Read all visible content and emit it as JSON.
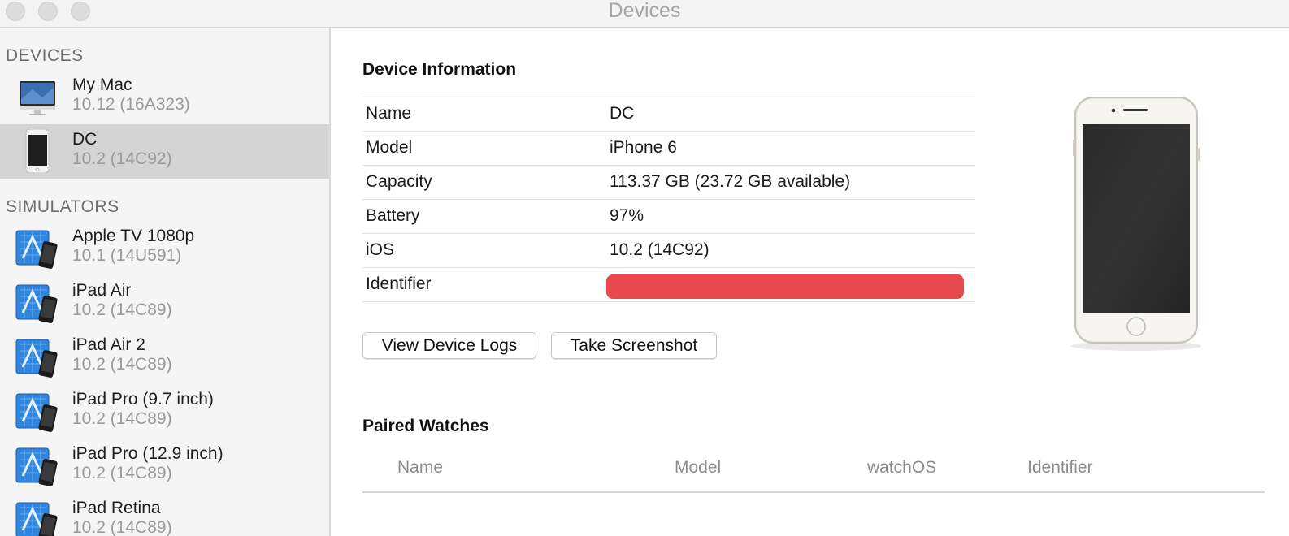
{
  "window": {
    "title": "Devices"
  },
  "sidebar": {
    "devices_header": "DEVICES",
    "simulators_header": "SIMULATORS",
    "devices": [
      {
        "name": "My Mac",
        "version": "10.12 (16A323)",
        "icon": "imac-icon"
      },
      {
        "name": "DC",
        "version": "10.2 (14C92)",
        "icon": "iphone-icon",
        "selected": true
      }
    ],
    "simulators": [
      {
        "name": "Apple TV 1080p",
        "version": "10.1 (14U591)"
      },
      {
        "name": "iPad Air",
        "version": "10.2 (14C89)"
      },
      {
        "name": "iPad Air 2",
        "version": "10.2 (14C89)"
      },
      {
        "name": "iPad Pro (9.7 inch)",
        "version": "10.2 (14C89)"
      },
      {
        "name": "iPad Pro (12.9 inch)",
        "version": "10.2 (14C89)"
      },
      {
        "name": "iPad Retina",
        "version": "10.2 (14C89)"
      }
    ]
  },
  "device_info": {
    "heading": "Device Information",
    "rows": [
      {
        "label": "Name",
        "value": "DC"
      },
      {
        "label": "Model",
        "value": "iPhone 6"
      },
      {
        "label": "Capacity",
        "value": "113.37 GB (23.72 GB available)"
      },
      {
        "label": "Battery",
        "value": "97%"
      },
      {
        "label": "iOS",
        "value": "10.2 (14C92)"
      },
      {
        "label": "Identifier",
        "value": ""
      }
    ],
    "redaction_color": "#e8494d"
  },
  "buttons": {
    "view_logs": "View Device Logs",
    "screenshot": "Take Screenshot"
  },
  "paired_watches": {
    "heading": "Paired Watches",
    "columns": [
      "Name",
      "Model",
      "watchOS",
      "Identifier"
    ]
  }
}
